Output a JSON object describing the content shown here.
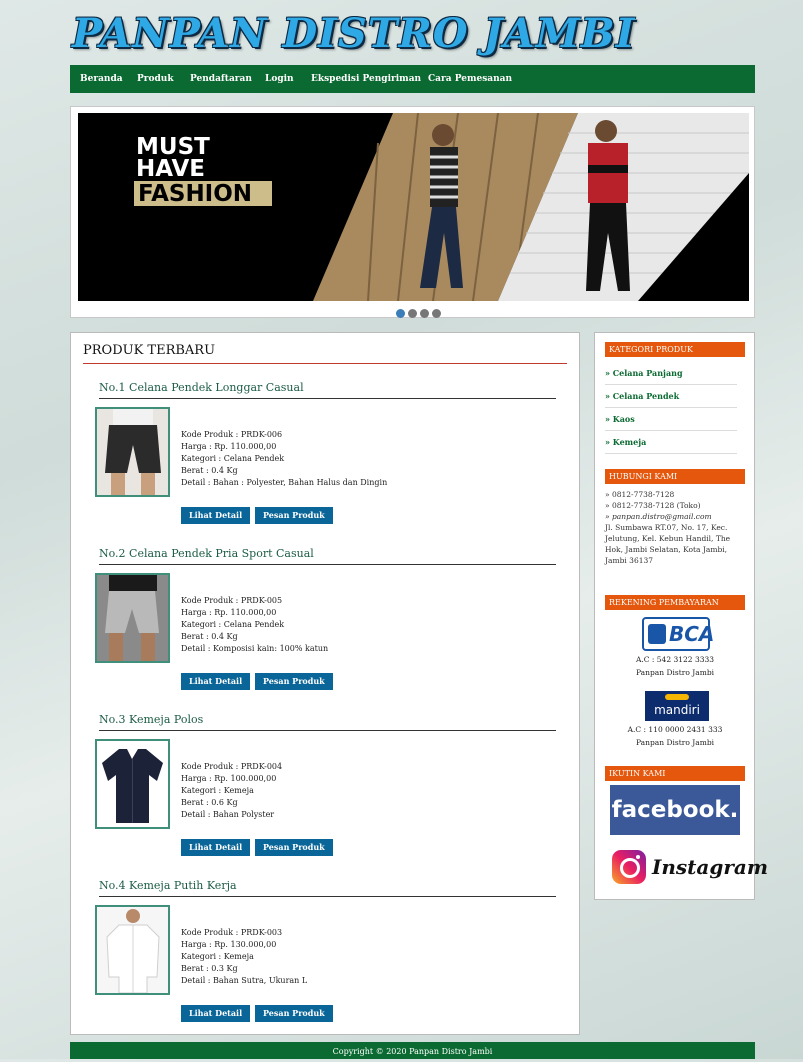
{
  "site": {
    "title": "PANPAN DISTRO JAMBI"
  },
  "nav": {
    "items": [
      "Beranda",
      "Produk",
      "Pendaftaran",
      "Login",
      "Ekspedisi Pengiriman",
      "Cara Pemesanan"
    ]
  },
  "banner": {
    "line1": "MUST",
    "line2": "HAVE",
    "line3": "FASHION"
  },
  "main": {
    "section_title": "PRODUK TERBARU",
    "products": [
      {
        "title": "No.1 Celana Pendek Longgar Casual",
        "kode": "Kode Produk : PRDK-006",
        "harga": "Harga : Rp. 110.000,00",
        "kategori": "Kategori : Celana Pendek",
        "berat": "Berat : 0.4 Kg",
        "detail": "Detail : Bahan : Polyester, Bahan Halus dan Dingin"
      },
      {
        "title": "No.2 Celana Pendek Pria Sport Casual",
        "kode": "Kode Produk : PRDK-005",
        "harga": "Harga : Rp. 110.000,00",
        "kategori": "Kategori : Celana Pendek",
        "berat": "Berat : 0.4 Kg",
        "detail": "Detail : Komposisi kain: 100% katun"
      },
      {
        "title": "No.3 Kemeja Polos",
        "kode": "Kode Produk : PRDK-004",
        "harga": "Harga : Rp. 100.000,00",
        "kategori": "Kategori : Kemeja",
        "berat": "Berat : 0.6 Kg",
        "detail": "Detail : Bahan Polyster"
      },
      {
        "title": "No.4 Kemeja Putih Kerja",
        "kode": "Kode Produk : PRDK-003",
        "harga": "Harga : Rp. 130.000,00",
        "kategori": "Kategori : Kemeja",
        "berat": "Berat : 0.3 Kg",
        "detail": "Detail : Bahan Sutra, Ukuran L"
      }
    ],
    "btn_detail": "Lihat Detail",
    "btn_order": "Pesan Produk"
  },
  "sidebar": {
    "kategori_title": "KATEGORI PRODUK",
    "kategori": [
      "» Celana Panjang",
      "» Celana Pendek",
      "» Kaos",
      "» Kemeja"
    ],
    "hubungi_title": "HUBUNGI KAMI",
    "phone1": "» 0812-7738-7128",
    "phone2": "» 0812-7738-7128 (Toko)",
    "email": "» panpan.distro@gmail.com",
    "address": "Jl. Sumbawa RT.07, No. 17, Kec. Jelutung, Kel. Kebun Handil, The Hok, Jambi Selatan, Kota Jambi, Jambi 36137",
    "rekening_title": "REKENING PEMBAYARAN",
    "bca_logo": "BCA",
    "bca_ac": "A.C : 542 3122 3333",
    "bca_name": "Panpan Distro Jambi",
    "mandiri_logo": "mandiri",
    "mandiri_ac": "A.C : 110 0000 2431 333",
    "mandiri_name": "Panpan Distro Jambi",
    "ikuti_title": "IKUTIN KAMI",
    "facebook": "facebook.",
    "instagram": "Instagram"
  },
  "footer": {
    "text": "Copyright © 2020 Panpan Distro Jambi"
  },
  "colors": {
    "nav_green": "#0b6a32",
    "accent_orange": "#e4570c",
    "button_blue": "#0a6598",
    "logo_blue": "#2fa9e6"
  }
}
